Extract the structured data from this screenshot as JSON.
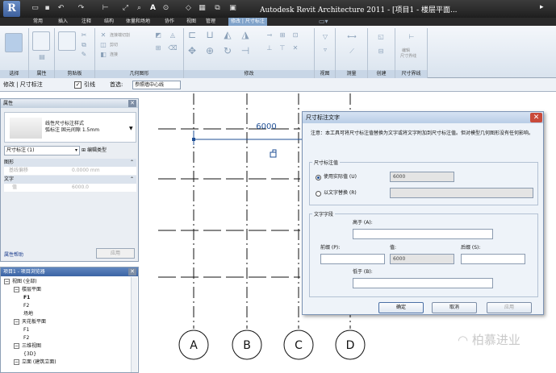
{
  "app": {
    "logo_text": "R",
    "window_title": "Autodesk Revit Architecture 2011 - [项目1 - 楼层平面...",
    "title_menu": "▸"
  },
  "ribbon_tabs": [
    "常用",
    "插入",
    "注释",
    "结构",
    "体量和场地",
    "协作",
    "视图",
    "管理",
    "修改 | 尺寸标注"
  ],
  "ribbon_panels": [
    "选择",
    "属性",
    "剪贴板",
    "几何图形",
    "修改",
    "视图",
    "测量",
    "创建",
    "尺寸界线"
  ],
  "ribbon_gray_labels": [
    "连接端切割",
    "剪切",
    "连接",
    "编辑",
    "尺寸界线"
  ],
  "options_bar": {
    "context": "修改 | 尺寸标注",
    "leader_check": "✓",
    "leader_label": "引线",
    "prefer_label": "首选:",
    "prefer_value": "参照墙中心线"
  },
  "properties": {
    "title": "属性",
    "type_name_line1": "线性尺寸标注样式",
    "type_name_line2": "弧标注 固元间隙 1.5mm",
    "selector_value": "尺寸标注 (1)",
    "edit_type": "编辑类型",
    "section_graphics": "图形",
    "row_lead": "基线偏移",
    "row_lead_value": "0.0000 mm",
    "section_text": "文字",
    "row_value_label": "值",
    "row_value_value": "6000.0",
    "help_link": "属性帮助",
    "apply_button": "应用"
  },
  "browser": {
    "title": "项目1 - 项目浏览器",
    "items": [
      {
        "label": "视图 (全部)",
        "level": 0,
        "toggle": "−"
      },
      {
        "label": "楼层平面",
        "level": 1,
        "toggle": "−"
      },
      {
        "label": "F1",
        "level": 2,
        "bold": true
      },
      {
        "label": "F2",
        "level": 2
      },
      {
        "label": "场地",
        "level": 2
      },
      {
        "label": "天花板平面",
        "level": 1,
        "toggle": "−"
      },
      {
        "label": "F1",
        "level": 2
      },
      {
        "label": "F2",
        "level": 2
      },
      {
        "label": "三维视图",
        "level": 1,
        "toggle": "−"
      },
      {
        "label": "{3D}",
        "level": 2
      },
      {
        "label": "立面 (建筑立面)",
        "level": 1,
        "toggle": "−"
      }
    ]
  },
  "canvas": {
    "dimension_value": "6000",
    "grid_labels": [
      "A",
      "B",
      "C",
      "D"
    ],
    "grid_line_color": "#111111",
    "dimension_color": "#1f4f95"
  },
  "dialog": {
    "title": "尺寸标注文字",
    "note": "注意：本工具可将尺寸标注值替换为文字或将文字附加到尺寸标注值。但对模型几何图形没有任何影响。",
    "group_value": "尺寸标注值",
    "use_actual_label": "使用实际值 (U)",
    "use_actual_value": "6000",
    "replace_label": "以文字替换 (R)",
    "replace_value": "",
    "group_text": "文字字段",
    "above_label": "高于 (A):",
    "prefix_label": "前缀 (P):",
    "value_label": "值:",
    "value_value": "6000",
    "suffix_label": "后缀 (S):",
    "below_label": "低于 (B):",
    "ok": "确定",
    "cancel": "取消",
    "apply": "应用"
  },
  "watermark": "柏慕进业",
  "colors": {
    "accent": "#6aa0d8",
    "close_red": "#c94a3a",
    "title_dark": "#1e1e1e"
  }
}
